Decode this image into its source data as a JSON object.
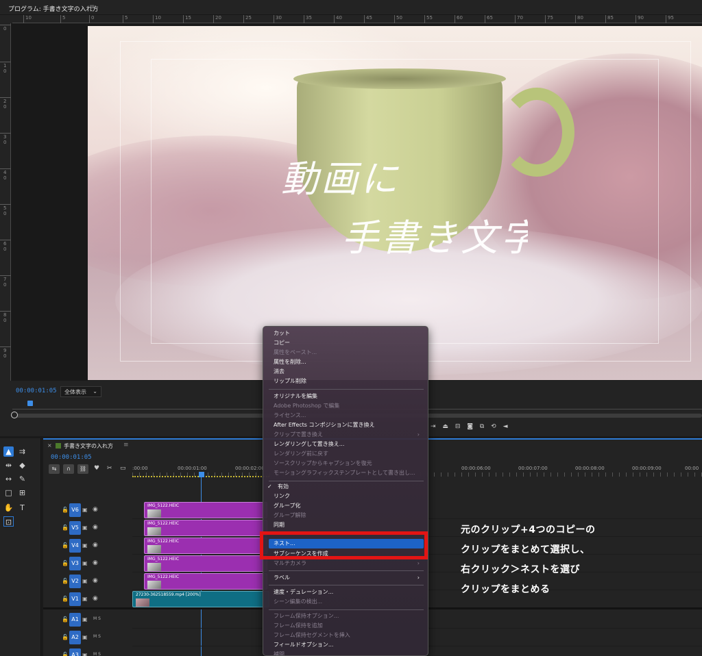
{
  "program_monitor": {
    "title": "プログラム: 手書き文字の入れ方",
    "ruler_top_labels": [
      "10",
      "5",
      "0",
      "5",
      "10",
      "15",
      "20",
      "25",
      "30",
      "35",
      "40",
      "45",
      "50",
      "55",
      "60",
      "65",
      "70",
      "75",
      "80",
      "85",
      "90",
      "95"
    ],
    "ruler_left_labels": [
      "0",
      "1 0",
      "2 0",
      "3 0",
      "4 0",
      "5 0",
      "6 0",
      "7 0",
      "8 0",
      "9 0"
    ],
    "overlay_text_line1": "動画に",
    "overlay_text_line2": "手書き文字",
    "timecode": "00:00:01:05",
    "zoom_value": "全体表示"
  },
  "timeline": {
    "sequence_title": "手書き文字の入れ方",
    "timecode": "00:00:01:05",
    "ruler_labels": [
      ":00:00",
      "00:00:01:00",
      "00:00:02:00",
      "00:00:06:00",
      "00:00:07:00",
      "00:00:08:00",
      "00:00:09:00",
      "00:00"
    ],
    "video_tracks": [
      {
        "name": "V6",
        "clip": "IMG_5122.HEIC"
      },
      {
        "name": "V5",
        "clip": "IMG_5122.HEIC"
      },
      {
        "name": "V4",
        "clip": "IMG_5122.HEIC"
      },
      {
        "name": "V3",
        "clip": "IMG_5122.HEIC"
      },
      {
        "name": "V2",
        "clip": "IMG_5122.HEIC"
      },
      {
        "name": "V1",
        "clip": "27230-362518559.mp4 [200%]"
      }
    ],
    "audio_tracks": [
      {
        "name": "A1"
      },
      {
        "name": "A2"
      },
      {
        "name": "A3"
      }
    ],
    "ms_label": "M  S"
  },
  "context_menu": {
    "items": [
      {
        "label": "カット",
        "enabled": true
      },
      {
        "label": "コピー",
        "enabled": true
      },
      {
        "label": "属性をペースト...",
        "enabled": false
      },
      {
        "label": "属性を削除...",
        "enabled": true
      },
      {
        "label": "消去",
        "enabled": true
      },
      {
        "label": "リップル削除",
        "enabled": true
      },
      {
        "label": "オリジナルを編集",
        "enabled": true
      },
      {
        "label": "Adobe Photoshop で編集",
        "enabled": false
      },
      {
        "label": "ライセンス...",
        "enabled": false
      },
      {
        "label": "After Effects コンポジションに置き換え",
        "enabled": true
      },
      {
        "label": "クリップで置き換え",
        "enabled": false
      },
      {
        "label": "レンダリングして置き換え...",
        "enabled": true
      },
      {
        "label": "レンダリング前に戻す",
        "enabled": false
      },
      {
        "label": "ソースクリップからキャプションを復元",
        "enabled": false
      },
      {
        "label": "モーショングラフィックステンプレートとして書き出し...",
        "enabled": false
      },
      {
        "label": "有効",
        "enabled": true,
        "checked": true
      },
      {
        "label": "リンク",
        "enabled": true
      },
      {
        "label": "グループ化",
        "enabled": true
      },
      {
        "label": "グループ解除",
        "enabled": false
      },
      {
        "label": "同期",
        "enabled": true
      },
      {
        "label": "ネスト...",
        "enabled": true,
        "highlighted": true
      },
      {
        "label": "サブシーケンスを作成",
        "enabled": true
      },
      {
        "label": "マルチカメラ",
        "enabled": false
      },
      {
        "label": "ラベル",
        "enabled": true
      },
      {
        "label": "速度・デュレーション...",
        "enabled": true
      },
      {
        "label": "シーン編集の検出...",
        "enabled": false
      },
      {
        "label": "フレーム保持オプション...",
        "enabled": false
      },
      {
        "label": "フレーム保持を追加",
        "enabled": false
      },
      {
        "label": "フレーム保持セグメントを挿入",
        "enabled": false
      },
      {
        "label": "フィールドオプション...",
        "enabled": true
      },
      {
        "label": "補間",
        "enabled": false
      }
    ],
    "submenu_arrow": "›",
    "check_mark": "✓"
  },
  "annotation": {
    "lines": [
      "元のクリップ+4つのコピーの",
      "クリップをまとめて選択し、",
      "右クリック＞ネストを選び",
      "クリップをまとめる"
    ]
  },
  "colors": {
    "accent_blue": "#2e7bd6",
    "clip_purple": "#9b2fb0",
    "clip_teal": "#0f6e84",
    "highlight_red": "#e31414",
    "timecode_blue": "#3d8ee8"
  },
  "icons": {
    "selection_tool": "selection-arrow-icon",
    "track_select": "track-select-forward-icon",
    "ripple_edit": "ripple-edit-icon",
    "razor": "razor-icon",
    "slip": "slip-icon",
    "pen": "pen-icon",
    "rectangle": "rectangle-icon",
    "hand": "hand-icon",
    "type": "type-icon"
  }
}
